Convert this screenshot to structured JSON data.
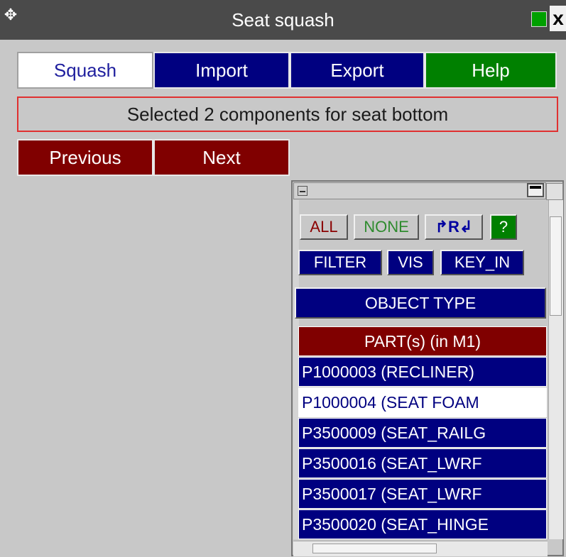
{
  "window": {
    "title": "Seat squash",
    "move_icon": "move-cross-icon",
    "close_glyph": "x"
  },
  "tabs": [
    {
      "label": "Squash",
      "active": true
    },
    {
      "label": "Import"
    },
    {
      "label": "Export"
    },
    {
      "label": "Help"
    }
  ],
  "status": {
    "text": "Selected 2 components for seat bottom"
  },
  "nav": {
    "previous": "Previous",
    "next": "Next"
  },
  "selector": {
    "all": "ALL",
    "none": "NONE",
    "r": "R",
    "help": "?",
    "filter": "FILTER",
    "vis": "VIS",
    "key_in": "KEY_IN",
    "object_type": "OBJECT TYPE",
    "header": "PART(s) (in M1)",
    "rows": [
      {
        "label": "P1000003 (RECLINER)",
        "selected": true
      },
      {
        "label": "P1000004 (SEAT FOAM",
        "selected": false
      },
      {
        "label": "P3500009 (SEAT_RAILG",
        "selected": true
      },
      {
        "label": "P3500016 (SEAT_LWRF",
        "selected": true
      },
      {
        "label": "P3500017 (SEAT_LWRF",
        "selected": true
      },
      {
        "label": "P3500020 (SEAT_HINGE",
        "selected": true
      }
    ]
  },
  "colors": {
    "selected": "#000080",
    "unselected": "#ffffff",
    "header": "#800000",
    "help": "#008000"
  }
}
